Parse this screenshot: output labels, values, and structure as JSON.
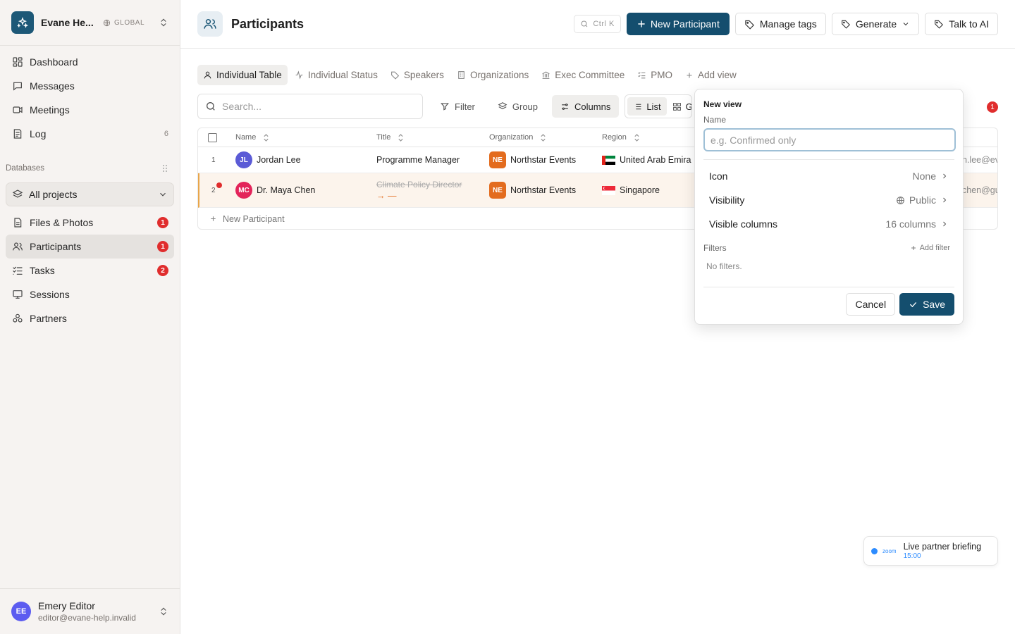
{
  "workspace": {
    "name": "Evane He...",
    "scope": "GLOBAL"
  },
  "nav": [
    {
      "label": "Dashboard",
      "icon": "dashboard-icon"
    },
    {
      "label": "Messages",
      "icon": "message-icon"
    },
    {
      "label": "Meetings",
      "icon": "video-icon"
    },
    {
      "label": "Log",
      "icon": "log-icon",
      "count": "6"
    }
  ],
  "databases": {
    "heading": "Databases",
    "project_selector": "All projects",
    "items": [
      {
        "label": "Files & Photos",
        "badge": "1"
      },
      {
        "label": "Participants",
        "badge": "1"
      },
      {
        "label": "Tasks",
        "badge": "2"
      },
      {
        "label": "Sessions"
      },
      {
        "label": "Partners"
      }
    ]
  },
  "user": {
    "initials": "EE",
    "name": "Emery Editor",
    "email": "editor@evane-help.invalid"
  },
  "header": {
    "title": "Participants",
    "shortcut": "Ctrl K",
    "new_button": "New Participant",
    "manage_tags": "Manage tags",
    "generate": "Generate",
    "talk_ai": "Talk to AI"
  },
  "tabs": [
    "Individual Table",
    "Individual Status",
    "Speakers",
    "Organizations",
    "Exec Committee",
    "PMO",
    "Add view"
  ],
  "toolbar": {
    "search_placeholder": "Search...",
    "filter": "Filter",
    "group": "Group",
    "columns": "Columns",
    "list": "List",
    "grid": "G",
    "alert_count": "1"
  },
  "table": {
    "columns": [
      "Name",
      "Title",
      "Organization",
      "Region"
    ],
    "rows": [
      {
        "num": "1",
        "initials": "JL",
        "name": "Jordan Lee",
        "title": "Programme Manager",
        "org_initials": "NE",
        "org": "Northstar Events",
        "region": "United Arab Emira",
        "email": "n.lee@evan"
      },
      {
        "num": "2",
        "initials": "MC",
        "name": "Dr. Maya Chen",
        "title_old": "Climate Policy Director",
        "title_new": "→ —",
        "org_initials": "NE",
        "org": "Northstar Events",
        "region": "Singapore",
        "email": "chen@gu"
      }
    ],
    "new_row": "New Participant"
  },
  "new_view": {
    "title": "New view",
    "name_label": "Name",
    "name_placeholder": "e.g. Confirmed only",
    "icon_label": "Icon",
    "icon_value": "None",
    "visibility_label": "Visibility",
    "visibility_value": "Public",
    "columns_label": "Visible columns",
    "columns_value": "16 columns",
    "filters_label": "Filters",
    "add_filter": "Add filter",
    "no_filters": "No filters.",
    "cancel": "Cancel",
    "save": "Save"
  },
  "toast": {
    "brand": "zoom",
    "title": "Live partner briefing",
    "time": "15:00"
  },
  "colors": {
    "primary": "#144e6e",
    "badge": "#e02d2d",
    "jl_avatar": "#5b5bd6",
    "mc_avatar": "#e3245a",
    "org": "#e36c1e"
  }
}
